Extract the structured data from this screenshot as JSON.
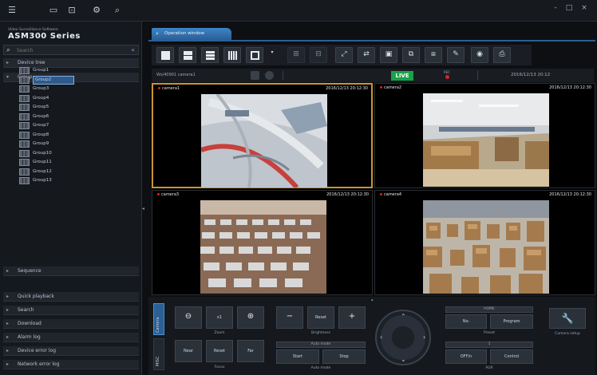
{
  "top": {
    "icons": [
      "menu-icon",
      "monitor-icon",
      "screen-icon",
      "settings-icon",
      "search-icon"
    ],
    "window_controls": [
      "-",
      "□",
      "×"
    ]
  },
  "brand": {
    "subtitle": "Video Surveillance Software",
    "title": "ASM300 Series"
  },
  "search": {
    "placeholder": "Search"
  },
  "sidebar": {
    "device_tree": "Device tree",
    "group": "Group",
    "groups": [
      "Group1",
      "Group2",
      "Group3",
      "Group4",
      "Group5",
      "Group6",
      "Group7",
      "Group8",
      "Group9",
      "Group10",
      "Group11",
      "Group12",
      "Group13"
    ],
    "selected_group": "Group2",
    "sequence": "Sequence",
    "bottom_sections": [
      "Quick playback",
      "Search",
      "Download",
      "Alarm log",
      "Device error log",
      "Network error log"
    ]
  },
  "tab": {
    "label": "Operation window"
  },
  "infobar": {
    "camera_name": "Ws/40901 camera1",
    "live": "LIVE",
    "rec": "REC",
    "datetime": "2016/12/13 20:12"
  },
  "cameras": [
    {
      "label": "camera1",
      "time": "2016/12/13 20:12:30",
      "selected": true
    },
    {
      "label": "camera2",
      "time": "2016/12/13 20:12:30",
      "selected": false
    },
    {
      "label": "camera3",
      "time": "2016/12/13 20:12:30",
      "selected": false
    },
    {
      "label": "camera4",
      "time": "2016/12/13 20:12:30",
      "selected": false
    }
  ],
  "controls": {
    "tab_camera": "Camera",
    "tab_misc": "MISC",
    "zoom_label": "Zoom",
    "zoom_x1": "x1",
    "focus_label": "Focus",
    "focus_near": "Near",
    "focus_auto": "Reset",
    "focus_far": "Far",
    "brightness_label": "Brightness",
    "brightness_reset": "Reset",
    "auto_mode_label": "Auto mode",
    "auto_mode_title": "Auto mode",
    "auto_start": "Start",
    "auto_stop": "Stop",
    "preset_label": "Preset",
    "preset_home": "HOME",
    "preset_no": "No.",
    "preset_program": "Program",
    "aux_label": "AUX",
    "aux_value": "1",
    "aux_off": "OFF/n",
    "aux_control": "Control",
    "camera_setup_label": "Camera setup"
  }
}
